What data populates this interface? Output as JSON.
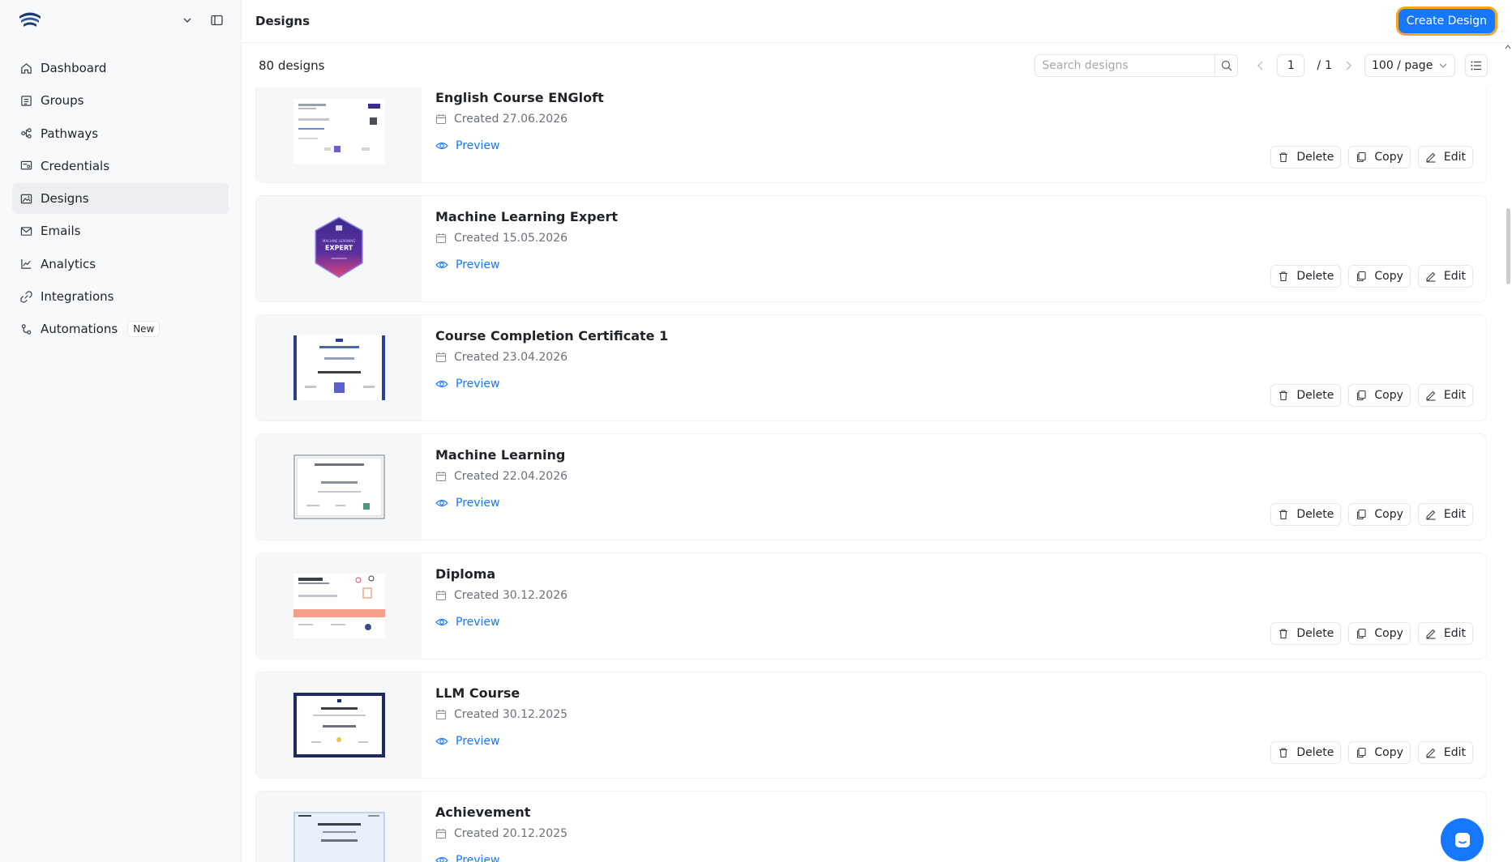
{
  "sidebar": {
    "items": [
      {
        "label": "Dashboard",
        "icon": "home-icon"
      },
      {
        "label": "Groups",
        "icon": "groups-icon"
      },
      {
        "label": "Pathways",
        "icon": "pathways-icon"
      },
      {
        "label": "Credentials",
        "icon": "credentials-icon"
      },
      {
        "label": "Designs",
        "icon": "designs-icon",
        "active": true
      },
      {
        "label": "Emails",
        "icon": "mail-icon"
      },
      {
        "label": "Analytics",
        "icon": "analytics-icon"
      },
      {
        "label": "Integrations",
        "icon": "integrations-icon"
      },
      {
        "label": "Automations",
        "icon": "automations-icon",
        "badge": "New"
      }
    ]
  },
  "header": {
    "title": "Designs",
    "create_label": "Create Design"
  },
  "toolbar": {
    "count": "80 designs",
    "search_placeholder": "Search designs",
    "page_current": "1",
    "page_separator": "/",
    "page_total": "1",
    "page_size": "100 / page"
  },
  "designs": [
    {
      "title": "English Course ENGloft",
      "created": "Created 27.06.2026",
      "preview": "Preview"
    },
    {
      "title": "Machine Learning Expert",
      "created": "Created 15.05.2026",
      "preview": "Preview"
    },
    {
      "title": "Course Completion Certificate 1",
      "created": "Created 23.04.2026",
      "preview": "Preview"
    },
    {
      "title": "Machine Learning",
      "created": "Created 22.04.2026",
      "preview": "Preview"
    },
    {
      "title": "Diploma",
      "created": "Created 30.12.2026",
      "preview": "Preview"
    },
    {
      "title": "LLM Course",
      "created": "Created 30.12.2025",
      "preview": "Preview"
    },
    {
      "title": "Achievement",
      "created": "Created 20.12.2025",
      "preview": "Preview"
    }
  ],
  "actions": {
    "delete": "Delete",
    "copy": "Copy",
    "edit": "Edit"
  },
  "colors": {
    "accent": "#1677ff",
    "highlight": "#f5a623"
  },
  "thumbnails": {
    "badge_line1": "MACHINE LEARNING",
    "badge_line2": "EXPERT"
  }
}
